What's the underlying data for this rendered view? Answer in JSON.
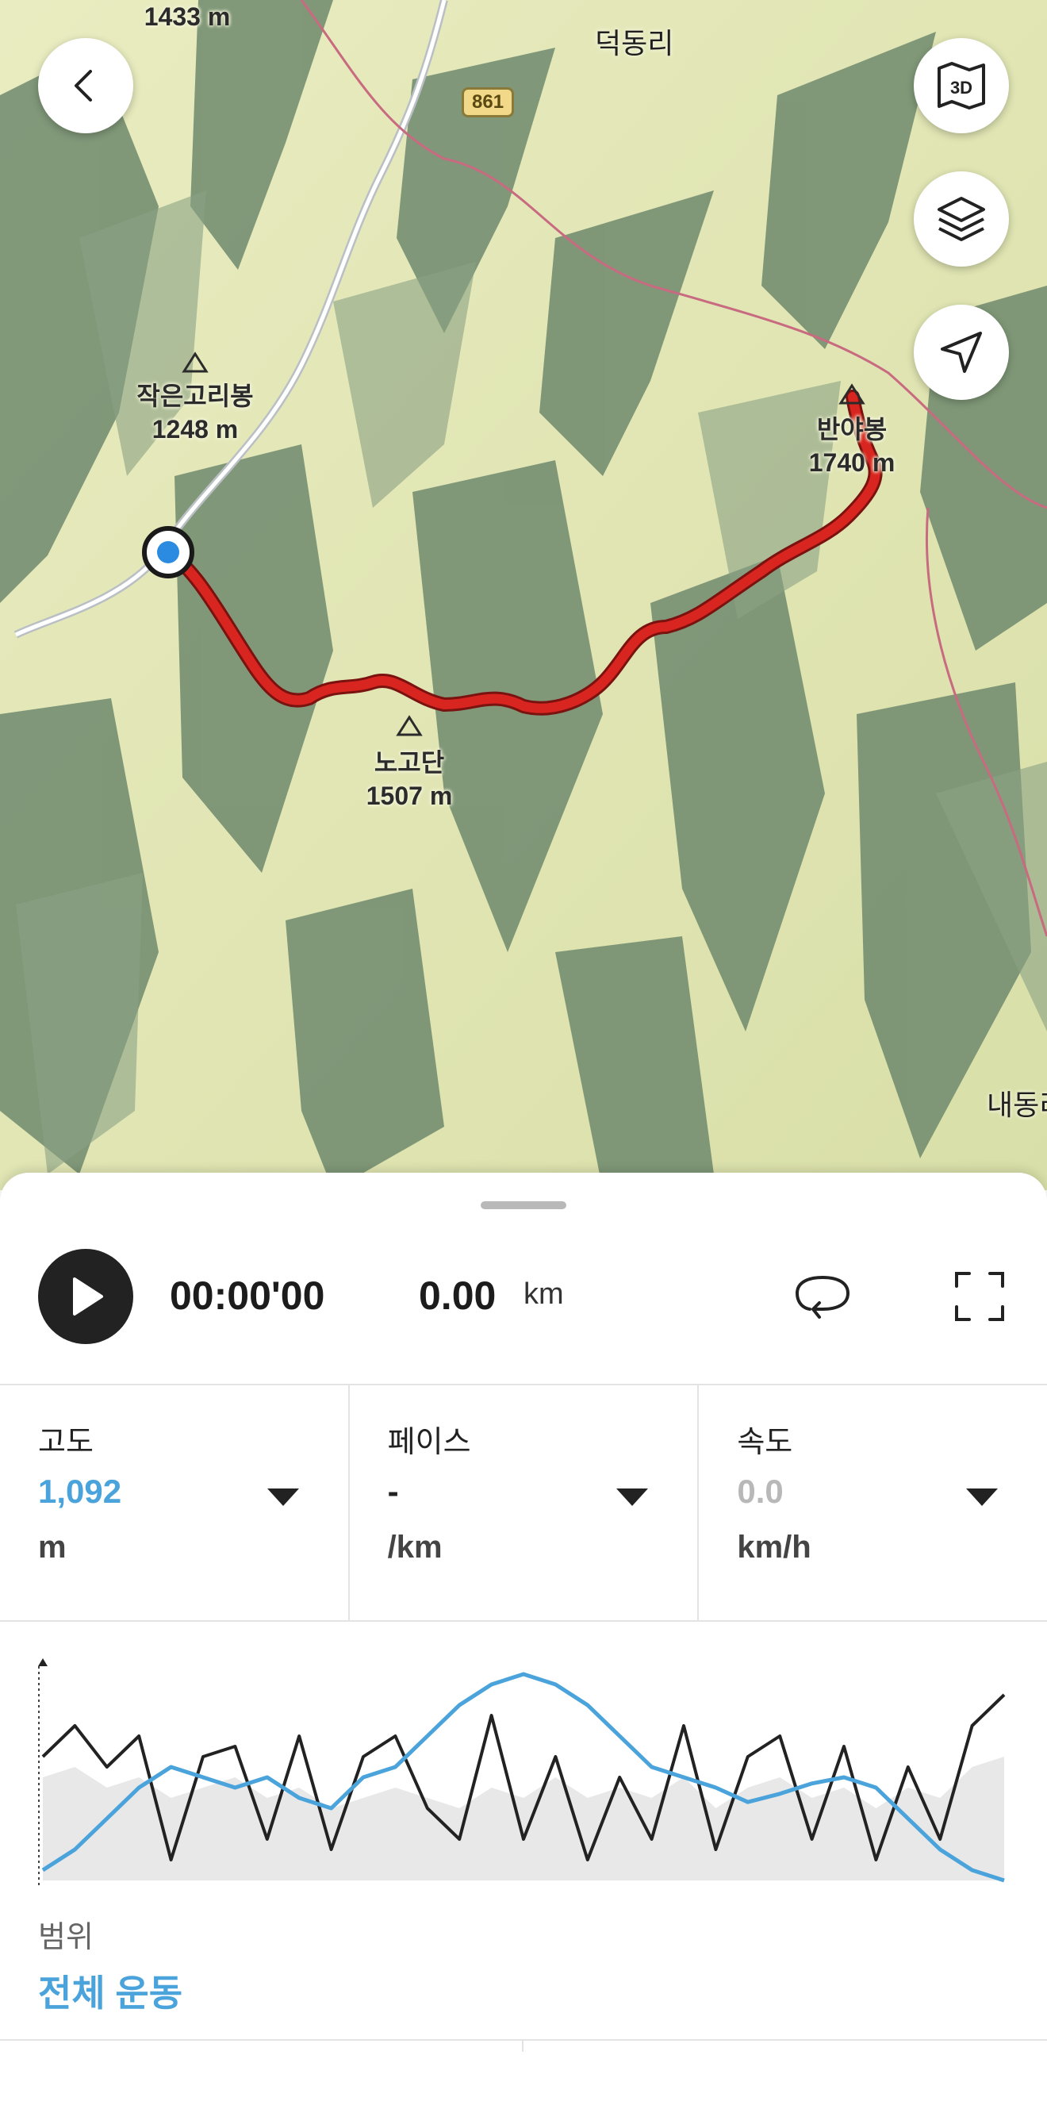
{
  "map": {
    "peaks": [
      {
        "name": "작은고리봉",
        "elevation": "1248 m"
      },
      {
        "name": "반야봉",
        "elevation": "1740 m"
      },
      {
        "name": "노고단",
        "elevation": "1507 m"
      },
      {
        "name": "",
        "elevation": "1433 m"
      }
    ],
    "villages": [
      "덕동리",
      "내동리"
    ],
    "road_number": "861",
    "buttons": {
      "back": "chevron-left-icon",
      "view3d": "3D",
      "layers": "layers-icon",
      "locate": "navigation-arrow-icon"
    },
    "route_color": "#d8251f"
  },
  "playback": {
    "time": "00:00'00",
    "distance": "0.00",
    "distance_unit": "km",
    "loop_icon": "loop-icon",
    "fullscreen_icon": "fullscreen-icon"
  },
  "metrics": [
    {
      "label": "고도",
      "value": "1,092",
      "unit": "m",
      "value_color": "#4aa3db"
    },
    {
      "label": "페이스",
      "value": "-",
      "unit": "/km",
      "value_color": "#222222"
    },
    {
      "label": "속도",
      "value": "0.0",
      "unit": "km/h",
      "value_color": "#b8b8b8"
    }
  ],
  "chart_data": {
    "type": "line",
    "series": [
      {
        "color": "#4aa3db",
        "values": [
          0.05,
          0.15,
          0.3,
          0.45,
          0.55,
          0.5,
          0.45,
          0.5,
          0.4,
          0.35,
          0.5,
          0.55,
          0.7,
          0.85,
          0.95,
          1.0,
          0.95,
          0.85,
          0.7,
          0.55,
          0.5,
          0.45,
          0.38,
          0.42,
          0.47,
          0.5,
          0.45,
          0.3,
          0.15,
          0.05,
          0.0
        ]
      },
      {
        "color": "#222222",
        "values": [
          0.6,
          0.75,
          0.55,
          0.7,
          0.1,
          0.6,
          0.65,
          0.2,
          0.7,
          0.15,
          0.6,
          0.7,
          0.35,
          0.2,
          0.8,
          0.2,
          0.6,
          0.1,
          0.5,
          0.2,
          0.75,
          0.15,
          0.6,
          0.7,
          0.2,
          0.65,
          0.1,
          0.55,
          0.2,
          0.75,
          0.9
        ]
      },
      {
        "color": "#e8e8e8",
        "values": [
          0.5,
          0.55,
          0.45,
          0.5,
          0.4,
          0.45,
          0.5,
          0.4,
          0.45,
          0.35,
          0.4,
          0.45,
          0.4,
          0.35,
          0.45,
          0.4,
          0.5,
          0.4,
          0.45,
          0.4,
          0.5,
          0.35,
          0.45,
          0.5,
          0.4,
          0.45,
          0.35,
          0.45,
          0.4,
          0.55,
          0.6
        ]
      }
    ]
  },
  "range": {
    "label": "범위",
    "value": "전체 운동"
  }
}
